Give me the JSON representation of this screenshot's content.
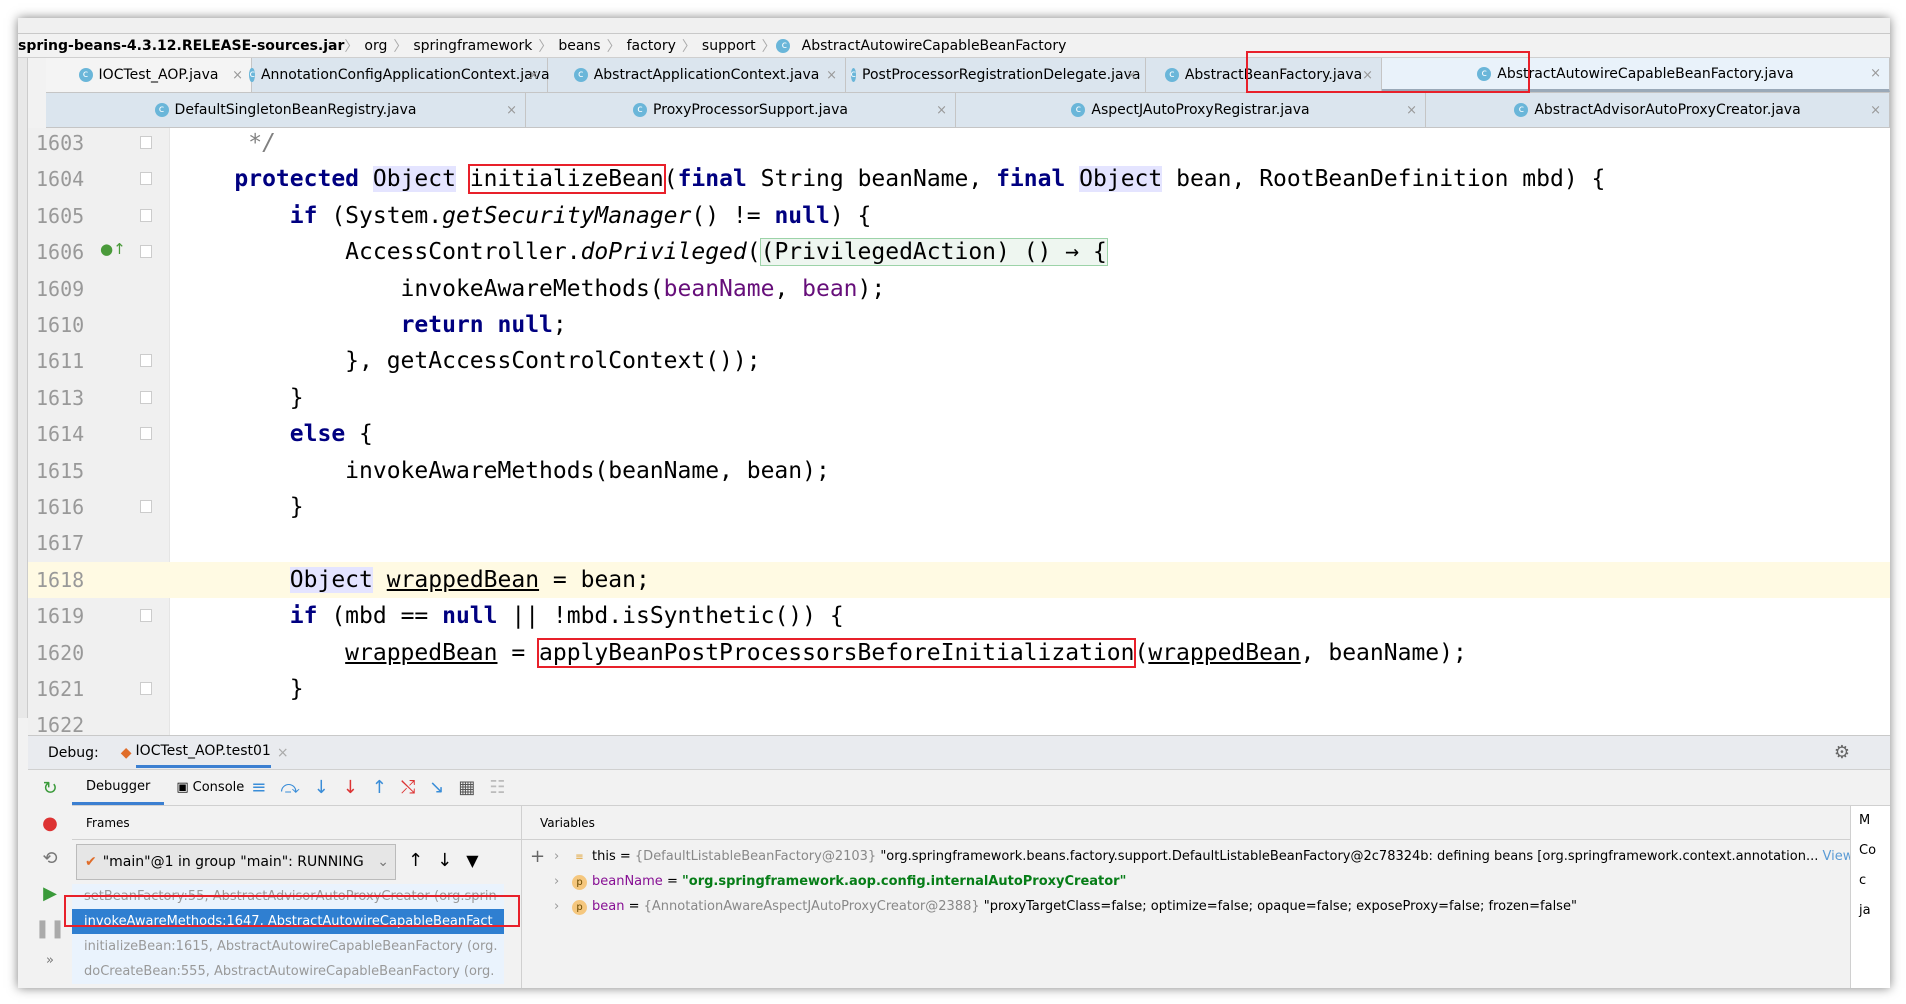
{
  "breadcrumb": [
    "spring-beans-4.3.12.RELEASE-sources.jar",
    "org",
    "springframework",
    "beans",
    "factory",
    "support",
    "AbstractAutowireCapableBeanFactory"
  ],
  "tabs_row1": [
    {
      "label": "IOCTest_AOP.java"
    },
    {
      "label": "AnnotationConfigApplicationContext.java"
    },
    {
      "label": "AbstractApplicationContext.java"
    },
    {
      "label": "PostProcessorRegistrationDelegate.java"
    },
    {
      "label": "AbstractBeanFactory.java"
    },
    {
      "label": "AbstractAutowireCapableBeanFactory.java",
      "active": true
    }
  ],
  "tabs_row2": [
    {
      "label": "DefaultSingletonBeanRegistry.java"
    },
    {
      "label": "ProxyProcessorSupport.java"
    },
    {
      "label": "AspectJAutoProxyRegistrar.java"
    },
    {
      "label": "AbstractAdvisorAutoProxyCreator.java"
    }
  ],
  "close_glyph": "×",
  "code": [
    {
      "n": "1603",
      "t": [
        [
          "     "
        ],
        [
          "*/",
          "cm"
        ]
      ]
    },
    {
      "n": "1604",
      "t": [
        [
          "    "
        ],
        [
          "protected",
          "k"
        ],
        [
          " "
        ],
        [
          "Object",
          "h"
        ],
        [
          " "
        ],
        [
          "initializeBean"
        ],
        [
          "("
        ],
        [
          "final",
          "k"
        ],
        [
          " String beanName, "
        ],
        [
          "final",
          "k"
        ],
        [
          " "
        ],
        [
          "Object",
          "h"
        ],
        [
          " bean, RootBeanDefinition mbd) {"
        ]
      ]
    },
    {
      "n": "1605",
      "t": [
        [
          "        "
        ],
        [
          "if",
          "k"
        ],
        [
          " (System."
        ],
        [
          "getSecurityManager",
          "m"
        ],
        [
          "() != "
        ],
        [
          "null",
          "k"
        ],
        [
          ") {"
        ]
      ]
    },
    {
      "n": "1606",
      "t": [
        [
          "            AccessController."
        ],
        [
          "doPrivileged",
          "m"
        ],
        [
          "("
        ],
        [
          "(PrivilegedAction) () → {",
          "lam"
        ]
      ]
    },
    {
      "n": "1609",
      "t": [
        [
          "                invokeAwareMethods("
        ],
        [
          "beanName",
          "p"
        ],
        [
          ", "
        ],
        [
          "bean",
          "p"
        ],
        [
          ");"
        ]
      ]
    },
    {
      "n": "1610",
      "t": [
        [
          "                "
        ],
        [
          "return",
          "k"
        ],
        [
          " "
        ],
        [
          "null",
          "k"
        ],
        [
          ";"
        ]
      ]
    },
    {
      "n": "1611",
      "t": [
        [
          "            }, getAccessControlContext());"
        ]
      ]
    },
    {
      "n": "1613",
      "t": [
        [
          "        }"
        ]
      ]
    },
    {
      "n": "1614",
      "t": [
        [
          "        "
        ],
        [
          "else",
          "k"
        ],
        [
          " {"
        ]
      ]
    },
    {
      "n": "1615",
      "t": [
        [
          "            invokeAwareMethods(beanName, bean);"
        ]
      ]
    },
    {
      "n": "1616",
      "t": [
        [
          "        }"
        ]
      ]
    },
    {
      "n": "1617",
      "t": [
        [
          ""
        ]
      ]
    },
    {
      "n": "1618",
      "cur": true,
      "t": [
        [
          "        "
        ],
        [
          "Object",
          "h"
        ],
        [
          " "
        ],
        [
          "wrappedBean",
          "u"
        ],
        [
          " = bean;"
        ]
      ]
    },
    {
      "n": "1619",
      "t": [
        [
          "        "
        ],
        [
          "if",
          "k"
        ],
        [
          " (mbd == "
        ],
        [
          "null",
          "k"
        ],
        [
          " || !mbd.isSynthetic()) {"
        ]
      ]
    },
    {
      "n": "1620",
      "t": [
        [
          "            "
        ],
        [
          "wrappedBean",
          "u"
        ],
        [
          " = "
        ],
        [
          "applyBeanPostProcessorsBeforeInitialization"
        ],
        [
          "("
        ],
        [
          "wrappedBean",
          "u"
        ],
        [
          ", beanName);"
        ]
      ]
    },
    {
      "n": "1621",
      "t": [
        [
          "        }"
        ]
      ]
    },
    {
      "n": "1622",
      "t": [
        [
          ""
        ]
      ]
    }
  ],
  "debug": {
    "label": "Debug:",
    "session": "IOCTest_AOP.test01",
    "tabs": [
      "Debugger",
      "Console"
    ],
    "frames_label": "Frames",
    "variables_label": "Variables",
    "thread": "\"main\"@1 in group \"main\": RUNNING",
    "frames": [
      "setBeanFactory:55, AbstractAdvisorAutoProxyCreator (org.sprin",
      "invokeAwareMethods:1647, AbstractAutowireCapableBeanFact",
      "initializeBean:1615, AbstractAutowireCapableBeanFactory (org.",
      "doCreateBean:555, AbstractAutowireCapableBeanFactory (org."
    ],
    "selected_frame": 1,
    "variables": [
      {
        "name": "this",
        "eq": " = ",
        "type": "{DefaultListableBeanFactory@2103} ",
        "value": "\"org.springframework.beans.factory.support.DefaultListableBeanFactory@2c78324b: defining beans [org.springframework.context.annotation...",
        "link": " View"
      },
      {
        "name": "beanName",
        "eq": " = ",
        "type": "",
        "value": "\"org.springframework.aop.config.internalAutoProxyCreator\""
      },
      {
        "name": "bean",
        "eq": " = ",
        "type": "{AnnotationAwareAspectJAutoProxyCreator@2388} ",
        "value": "\"proxyTargetClass=false; optimize=false; opaque=false; exposeProxy=false; frozen=false\""
      }
    ],
    "right_panel": [
      "M",
      "Co",
      "c",
      "ja"
    ]
  }
}
